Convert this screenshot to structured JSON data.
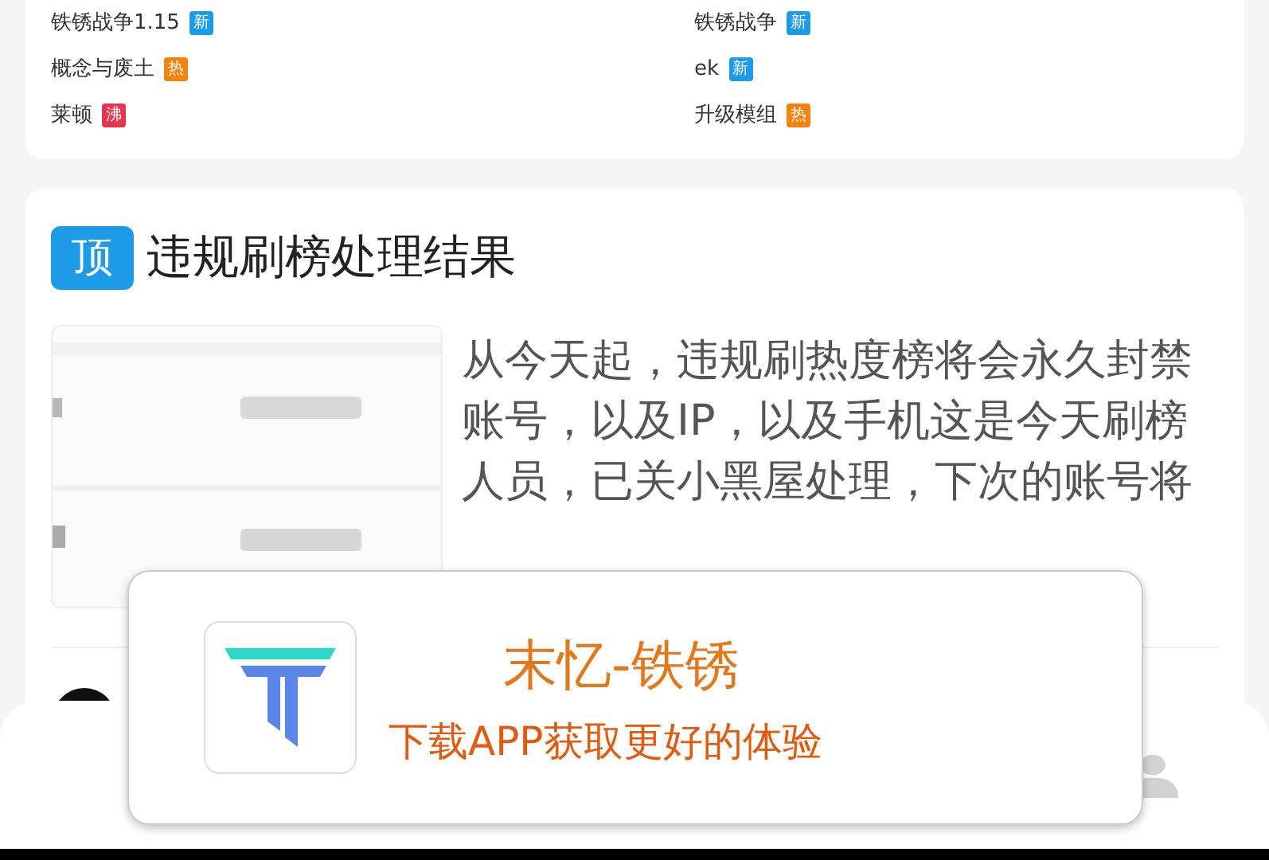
{
  "hot_list": [
    {
      "title": "铁锈战争1.15",
      "badge": "新",
      "color": "#1e9be8"
    },
    {
      "title": "铁锈战争",
      "badge": "新",
      "color": "#1e9be8"
    },
    {
      "title": "概念与废土",
      "badge": "热",
      "color": "#f5820f"
    },
    {
      "title": "ek",
      "badge": "新",
      "color": "#1e9be8"
    },
    {
      "title": "莱顿",
      "badge": "沸",
      "color": "#e8344e"
    },
    {
      "title": "升级模组",
      "badge": "热",
      "color": "#f5820f"
    }
  ],
  "post": {
    "tag": "顶",
    "title": "违规刷榜处理结果",
    "excerpt": "从今天起，违规刷热度榜将会永久封禁账号，以及IP，以及手机这是今天刷榜人员，已关小黑屋处理，下次的账号将"
  },
  "app_banner": {
    "name": "末忆-铁锈",
    "slogan": "下载APP获取更好的体验"
  }
}
